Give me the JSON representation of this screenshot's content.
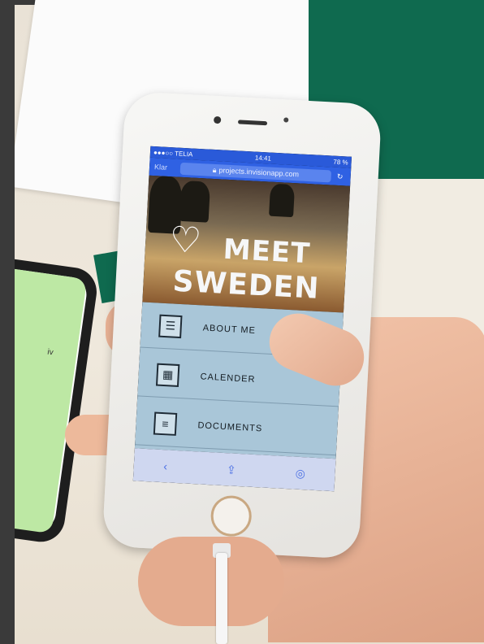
{
  "status_bar": {
    "carrier": "●●●○○ TELIA",
    "time": "14:41",
    "battery": "78 %"
  },
  "browser": {
    "done_label": "Klar",
    "url": "projects.invisionapp.com"
  },
  "app": {
    "title_line1": "MEET",
    "title_line2": "SWEDEN",
    "menu": [
      {
        "label": "ABOUT ME",
        "icon": "profile-icon"
      },
      {
        "label": "CALENDER",
        "icon": "calendar-icon"
      },
      {
        "label": "DOCUMENTS",
        "icon": "document-icon"
      }
    ]
  },
  "sketch": {
    "text": "iv"
  },
  "colors": {
    "accent": "#2f61e3",
    "menu_bg": "#a9c6d8",
    "table_green": "#0f6a4f"
  }
}
